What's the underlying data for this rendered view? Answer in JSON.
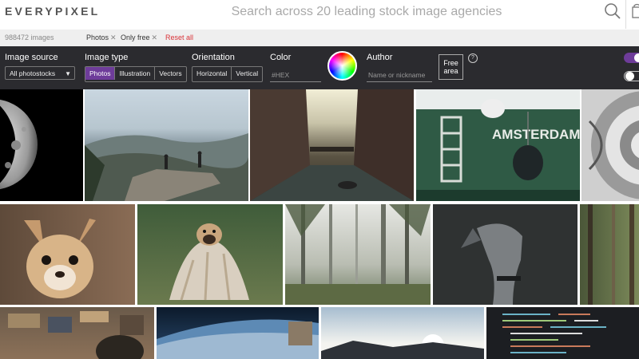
{
  "header": {
    "logo": "EVERYPIXEL",
    "search_placeholder": "Search across 20 leading stock image agencies",
    "search_icon": "search-icon",
    "menu_icon": "bag-icon"
  },
  "chips": {
    "count": "988472 images",
    "items": [
      "Photos",
      "Only free"
    ],
    "reset": "Reset all"
  },
  "filters": {
    "image_source": {
      "label": "Image source",
      "value": "All photostocks"
    },
    "image_type": {
      "label": "Image type",
      "options": [
        "Photos",
        "Illustration",
        "Vectors"
      ],
      "selected": "Photos"
    },
    "orientation": {
      "label": "Orientation",
      "options": [
        "Horizontal",
        "Vertical"
      ]
    },
    "color": {
      "label": "Color",
      "placeholder": "#HEX"
    },
    "author": {
      "label": "Author",
      "placeholder": "Name or nickname"
    },
    "free_area": {
      "label_line1": "Free",
      "label_line2": "area"
    },
    "help": "?",
    "toggles": [
      {
        "state": "on",
        "color": "#6e3c9a"
      },
      {
        "state": "off",
        "color": "#2b2b2f"
      }
    ]
  },
  "images": [
    "moon-photo",
    "hikers-on-cliff-photo",
    "canal-city-photo",
    "amsterdam-boat-photo",
    "spiral-staircase-photo",
    "chihuahua-photo",
    "pug-in-blanket-photo",
    "misty-forest-photo",
    "dog-dark-background-photo",
    "forest-partial-photo",
    "aerial-city-man-photo",
    "earth-from-space-photo",
    "sunset-mountains-photo",
    "code-screen-photo"
  ]
}
